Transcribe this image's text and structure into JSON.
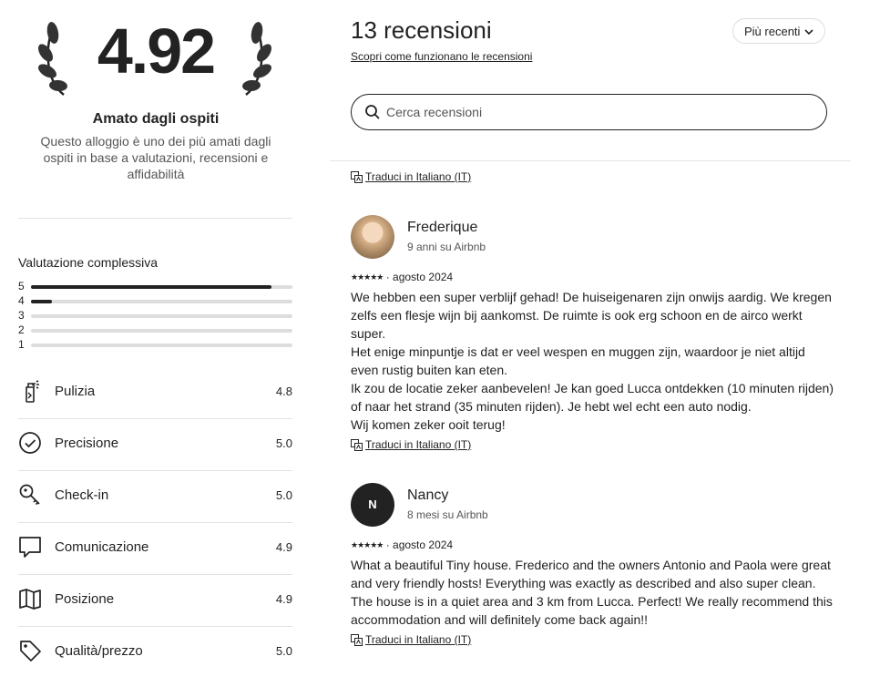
{
  "summary": {
    "rating": "4.92",
    "favorite_title": "Amato dagli ospiti",
    "favorite_desc": "Questo alloggio è uno dei più amati dagli ospiti in base a valutazioni, recensioni e affidabilità"
  },
  "overall": {
    "title": "Valutazione complessiva",
    "bars": [
      {
        "label": "5",
        "fraction": 0.92
      },
      {
        "label": "4",
        "fraction": 0.08
      },
      {
        "label": "3",
        "fraction": 0
      },
      {
        "label": "2",
        "fraction": 0
      },
      {
        "label": "1",
        "fraction": 0
      }
    ]
  },
  "categories": [
    {
      "label": "Pulizia",
      "value": "4.8",
      "icon": "spray-bottle-icon"
    },
    {
      "label": "Precisione",
      "value": "5.0",
      "icon": "check-circle-icon"
    },
    {
      "label": "Check-in",
      "value": "5.0",
      "icon": "key-icon"
    },
    {
      "label": "Comunicazione",
      "value": "4.9",
      "icon": "chat-bubble-icon"
    },
    {
      "label": "Posizione",
      "value": "4.9",
      "icon": "map-icon"
    },
    {
      "label": "Qualità/prezzo",
      "value": "5.0",
      "icon": "price-tag-icon"
    }
  ],
  "reviews_header": {
    "count_label": "13 recensioni",
    "how_link": "Scopri come funzionano le recensioni",
    "sort_label": "Più recenti",
    "search_placeholder": "Cerca recensioni"
  },
  "translate_label": "Traduci in Italiano (IT)",
  "reviews": [
    {
      "name": "Frederique",
      "meta": "9 anni su Airbnb",
      "stars": "★★★★★",
      "date": "agosto 2024",
      "text": "We hebben een super verblijf gehad! De huiseigenaren zijn onwijs aardig. We kregen zelfs een flesje wijn bij aankomst. De ruimte is ook erg schoon en de airco werkt super.\nHet enige minpuntje is dat er veel wespen en muggen zijn, waardoor je niet altijd even rustig buiten kan eten.\nIk zou de locatie zeker aanbevelen! Je kan goed Lucca ontdekken (10 minuten rijden)  of naar het strand (35 minuten rijden). Je hebt wel echt een auto nodig.\nWij komen zeker ooit terug!"
    },
    {
      "name": "Nancy",
      "initial": "N",
      "meta": "8 mesi su Airbnb",
      "stars": "★★★★★",
      "date": "agosto 2024",
      "text": "What a beautiful Tiny house. Frederico and the owners Antonio and Paola were great and very friendly hosts! Everything was exactly as described and also super clean. The house is in a quiet area and 3 km from Lucca. Perfect! We really recommend this accommodation and will definitely come back again!!"
    }
  ],
  "dot_separator": "·"
}
